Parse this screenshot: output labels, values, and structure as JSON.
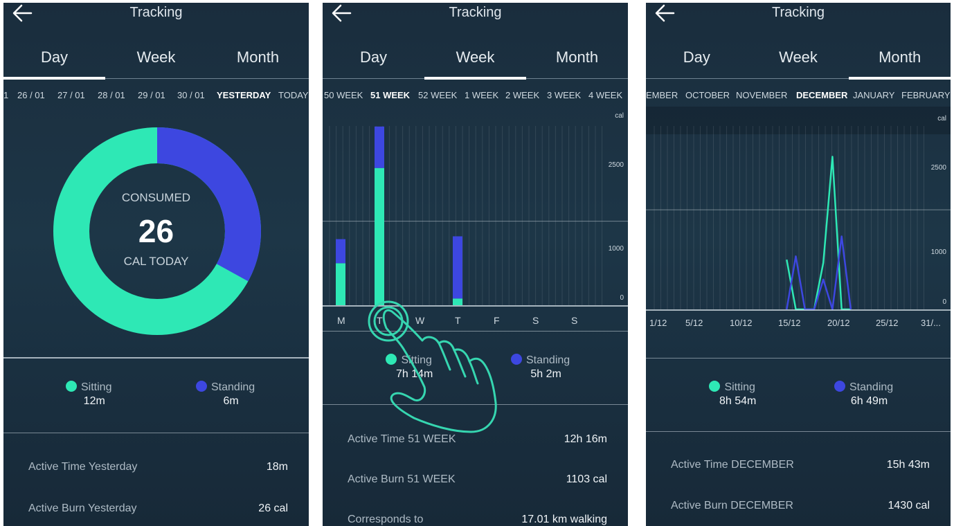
{
  "colors": {
    "sitting": "#2ee8b5",
    "standing": "#3d47e0",
    "hand": "#36d6b0"
  },
  "day_screen": {
    "title": "Tracking",
    "tabs": [
      "Day",
      "Week",
      "Month"
    ],
    "active_tab": "Day",
    "periods": [
      "1",
      "26 / 01",
      "27 / 01",
      "28 / 01",
      "29 / 01",
      "30 / 01",
      "YESTERDAY",
      "TODAY"
    ],
    "selected_period": "YESTERDAY",
    "donut": {
      "top_label": "CONSUMED",
      "value": "26",
      "bottom_label": "CAL TODAY",
      "standing_fraction": 0.33
    },
    "legend": [
      {
        "name": "Sitting",
        "value": "12m"
      },
      {
        "name": "Standing",
        "value": "6m"
      }
    ],
    "stats": [
      {
        "label": "Active Time Yesterday",
        "value": "18m"
      },
      {
        "label": "Active Burn Yesterday",
        "value": "26 cal"
      }
    ]
  },
  "week_screen": {
    "title": "Tracking",
    "tabs": [
      "Day",
      "Week",
      "Month"
    ],
    "active_tab": "Week",
    "periods": [
      "50 WEEK",
      "51 WEEK",
      "52 WEEK",
      "1 WEEK",
      "2 WEEK",
      "3 WEEK",
      "4 WEEK"
    ],
    "selected_period": "51 WEEK",
    "chart_unit": "cal",
    "y_ticks": [
      "2500",
      "1000",
      "0"
    ],
    "days": [
      "M",
      "T",
      "W",
      "T",
      "F",
      "S",
      "S"
    ],
    "legend": [
      {
        "name": "Sitting",
        "value": "7h 14m"
      },
      {
        "name": "Standing",
        "value": "5h 2m"
      }
    ],
    "stats": [
      {
        "label": "Active Time 51 WEEK",
        "value": "12h 16m"
      },
      {
        "label": "Active Burn 51 WEEK",
        "value": "1103 cal"
      },
      {
        "label": "Corresponds to",
        "value": "17.01 km walking"
      }
    ]
  },
  "month_screen": {
    "title": "Tracking",
    "tabs": [
      "Day",
      "Week",
      "Month"
    ],
    "active_tab": "Month",
    "periods": [
      "EMBER",
      "OCTOBER",
      "NOVEMBER",
      "DECEMBER",
      "JANUARY",
      "FEBRUARY"
    ],
    "selected_period": "DECEMBER",
    "chart_unit": "cal",
    "y_ticks": [
      "2500",
      "1000",
      "0"
    ],
    "x_ticks": [
      "1/12",
      "5/12",
      "10/12",
      "15/12",
      "20/12",
      "25/12",
      "31/..."
    ],
    "legend": [
      {
        "name": "Sitting",
        "value": "8h 54m"
      },
      {
        "name": "Standing",
        "value": "6h 49m"
      }
    ],
    "stats": [
      {
        "label": "Active Time DECEMBER",
        "value": "15h 43m"
      },
      {
        "label": "Active Burn DECEMBER",
        "value": "1430 cal"
      }
    ]
  },
  "chart_data": [
    {
      "type": "bar",
      "stacked": true,
      "categories": [
        "M",
        "T",
        "W",
        "T",
        "F",
        "S",
        "S"
      ],
      "series": [
        {
          "name": "Sitting",
          "values": [
            750,
            2450,
            120,
            0,
            0,
            0,
            0
          ]
        },
        {
          "name": "Standing",
          "values": [
            430,
            740,
            1110,
            0,
            0,
            0,
            0
          ]
        }
      ],
      "title": "",
      "xlabel": "",
      "ylabel": "cal",
      "ylim": [
        0,
        3200
      ],
      "yticks": [
        0,
        1000,
        2500
      ]
    },
    {
      "type": "line",
      "x": [
        15,
        16,
        17,
        18,
        19,
        20,
        21,
        22
      ],
      "series": [
        {
          "name": "Sitting",
          "values": [
            750,
            0,
            0,
            0,
            700,
            2300,
            0,
            0
          ]
        },
        {
          "name": "Standing",
          "values": [
            0,
            800,
            0,
            0,
            450,
            0,
            1100,
            0
          ]
        }
      ],
      "title": "",
      "xlabel": "",
      "ylabel": "cal",
      "ylim": [
        0,
        2950
      ],
      "xticks": [
        "1/12",
        "5/12",
        "10/12",
        "15/12",
        "20/12",
        "25/12",
        "31/..."
      ],
      "yticks": [
        0,
        1000,
        2500
      ]
    }
  ]
}
